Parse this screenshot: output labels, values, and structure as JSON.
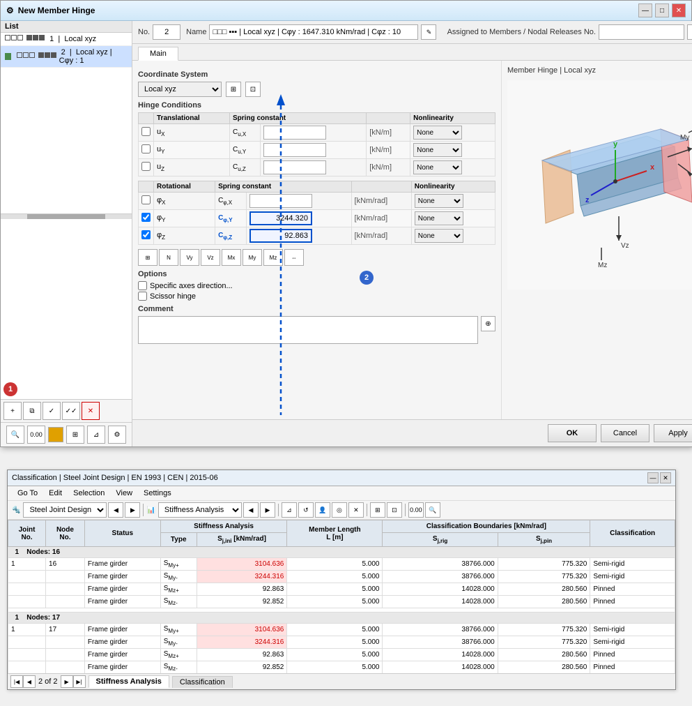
{
  "title": "New Member Hinge",
  "list": {
    "header": "List",
    "items": [
      {
        "id": 1,
        "label": "1  □□□  ☑☑☑  |  Local xyz",
        "selected": false
      },
      {
        "id": 2,
        "label": "2  □□□  ▪▪▪  |  Local xyz | Cφy : 1",
        "selected": true
      }
    ]
  },
  "no_label": "No.",
  "no_value": "2",
  "name_label": "Name",
  "name_value": "□□□  ▪▪▪  |  Local xyz | Cφy : 1647.310 kNm/rad | Cφz : 10",
  "assigned_label": "Assigned to Members / Nodal Releases No.",
  "tab_main": "Main",
  "coordinate_system": {
    "label": "Coordinate System",
    "value": "Local xyz"
  },
  "hinge_conditions": {
    "header": "Hinge Conditions",
    "translational": {
      "header": "Translational",
      "spring_constant": "Spring constant",
      "nonlinearity": "Nonlinearity",
      "rows": [
        {
          "sym": "uX",
          "sym_sub": "X",
          "spring_label": "Cu,X",
          "spring_value": "",
          "unit": "kN/m",
          "nonlin": "None",
          "checked": false
        },
        {
          "sym": "uY",
          "sym_sub": "Y",
          "spring_label": "Cu,Y",
          "spring_value": "",
          "unit": "kN/m",
          "nonlin": "None",
          "checked": false
        },
        {
          "sym": "uZ",
          "sym_sub": "Z",
          "spring_label": "Cu,Z",
          "spring_value": "",
          "unit": "kN/m",
          "nonlin": "None",
          "checked": false
        }
      ]
    },
    "rotational": {
      "header": "Rotational",
      "spring_constant": "Spring constant",
      "nonlinearity": "Nonlinearity",
      "rows": [
        {
          "sym": "φX",
          "sym_sub": "X",
          "spring_label": "Cφ,X",
          "spring_value": "",
          "unit": "kNm/rad",
          "nonlin": "None",
          "checked": false
        },
        {
          "sym": "φY",
          "sym_sub": "Y",
          "spring_label": "Cφ,Y",
          "spring_value": "3244.320",
          "unit": "kNm/rad",
          "nonlin": "None",
          "checked": true,
          "highlighted": true
        },
        {
          "sym": "φZ",
          "sym_sub": "Z",
          "spring_label": "Cφ,Z",
          "spring_value": "92.863",
          "unit": "kNm/rad",
          "nonlin": "None",
          "checked": true,
          "highlighted": true
        }
      ]
    }
  },
  "options": {
    "header": "Options",
    "specific_axes": "Specific axes direction...",
    "scissor_hinge": "Scissor hinge"
  },
  "comment_label": "Comment",
  "buttons": {
    "ok": "OK",
    "cancel": "Cancel",
    "apply": "Apply"
  },
  "preview_label": "Member Hinge | Local xyz",
  "second_window": {
    "title": "Classification | Steel Joint Design | EN 1993 | CEN | 2015-06",
    "menu": [
      "Go To",
      "Edit",
      "Selection",
      "View",
      "Settings"
    ],
    "toolbar1_select": "Steel Joint Design",
    "toolbar2_select": "Stiffness Analysis",
    "table": {
      "headers": [
        "Joint No.",
        "Node No.",
        "Status",
        "Stiffness Analysis Type",
        "S_j,ini [kNm/rad]",
        "Member Length L [m]",
        "S_j,rig [kNm/rad]",
        "S_j,pin",
        "Classification"
      ],
      "groups": [
        {
          "group_label": "1",
          "node_label": "Nodes: 16",
          "rows": [
            {
              "joint": "1",
              "node": "16",
              "status": "Frame girder",
              "type": "SMy+",
              "s_ini": "3104.636",
              "length": "5.000",
              "s_rig": "38766.000",
              "s_pin": "775.320",
              "classification": "Semi-rigid",
              "highlighted": true
            },
            {
              "joint": "",
              "node": "",
              "status": "Frame girder",
              "type": "SMy-",
              "s_ini": "3244.316",
              "length": "5.000",
              "s_rig": "38766.000",
              "s_pin": "775.320",
              "classification": "Semi-rigid",
              "highlighted": true
            },
            {
              "joint": "",
              "node": "",
              "status": "Frame girder",
              "type": "SMz+",
              "s_ini": "92.863",
              "length": "5.000",
              "s_rig": "14028.000",
              "s_pin": "280.560",
              "classification": "Pinned",
              "highlighted": false
            },
            {
              "joint": "",
              "node": "",
              "status": "Frame girder",
              "type": "SMz-",
              "s_ini": "92.852",
              "length": "5.000",
              "s_rig": "14028.000",
              "s_pin": "280.560",
              "classification": "Pinned",
              "highlighted": false
            }
          ]
        },
        {
          "group_label": "1",
          "node_label": "Nodes: 17",
          "rows": [
            {
              "joint": "1",
              "node": "17",
              "status": "Frame girder",
              "type": "SMy+",
              "s_ini": "3104.636",
              "length": "5.000",
              "s_rig": "38766.000",
              "s_pin": "775.320",
              "classification": "Semi-rigid",
              "highlighted": true
            },
            {
              "joint": "",
              "node": "",
              "status": "Frame girder",
              "type": "SMy-",
              "s_ini": "3244.316",
              "length": "5.000",
              "s_rig": "38766.000",
              "s_pin": "775.320",
              "classification": "Semi-rigid",
              "highlighted": true
            },
            {
              "joint": "",
              "node": "",
              "status": "Frame girder",
              "type": "SMz+",
              "s_ini": "92.863",
              "length": "5.000",
              "s_rig": "14028.000",
              "s_pin": "280.560",
              "classification": "Pinned",
              "highlighted": false
            },
            {
              "joint": "",
              "node": "",
              "status": "Frame girder",
              "type": "SMz-",
              "s_ini": "92.852",
              "length": "5.000",
              "s_rig": "14028.000",
              "s_pin": "280.560",
              "classification": "Pinned",
              "highlighted": false
            }
          ]
        }
      ]
    },
    "pagination": {
      "current": "2 of 2"
    },
    "tabs": [
      "Stiffness Analysis",
      "Classification"
    ]
  }
}
